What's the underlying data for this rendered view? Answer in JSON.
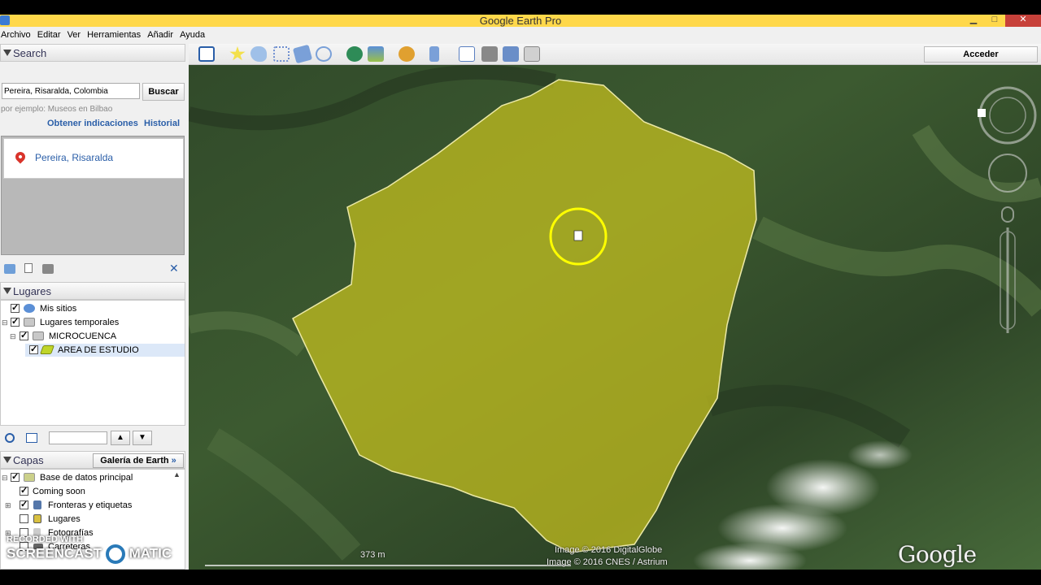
{
  "window": {
    "title": "Google Earth Pro",
    "minimize": "▁",
    "maximize": "□",
    "close": "✕"
  },
  "menu": [
    "Archivo",
    "Editar",
    "Ver",
    "Herramientas",
    "Añadir",
    "Ayuda"
  ],
  "search": {
    "title": "Search",
    "input_value": "Pereira, Risaralda, Colombia",
    "button_label": "Buscar",
    "hint": "por ejemplo: Museos en Bilbao",
    "directions_link": "Obtener indicaciones",
    "history_link": "Historial",
    "result": "Pereira, Risaralda"
  },
  "places": {
    "title": "Lugares",
    "items": [
      {
        "label": "Mis sitios",
        "checked": true
      },
      {
        "label": "Lugares temporales",
        "checked": true
      },
      {
        "label": "MICROCUENCA",
        "checked": true
      },
      {
        "label": "AREA DE ESTUDIO",
        "checked": true
      }
    ]
  },
  "layers": {
    "title": "Capas",
    "gallery_button": "Galería de Earth",
    "gallery_arrow": "»",
    "items": [
      {
        "label": "Base de datos principal",
        "checked": true
      },
      {
        "label": "Coming soon",
        "checked": true
      },
      {
        "label": "Fronteras y etiquetas",
        "checked": true
      },
      {
        "label": "Lugares",
        "checked": false
      },
      {
        "label": "Fotografías",
        "checked": false
      },
      {
        "label": "Carreteras",
        "checked": false
      }
    ]
  },
  "toolbar": {
    "signin_label": "Acceder"
  },
  "map": {
    "attribution_1": "Image © 2016 DigitalGlobe",
    "attribution_2": "Image © 2016 CNES / Astrium",
    "scale": "373 m",
    "logo": "Google earth",
    "polygon_color": "#c8c21e",
    "cursor_ring_color": "#ffff00"
  },
  "watermark": {
    "line1": "RECORDED WITH",
    "line2": "SCREENCAST",
    "line3": "MATIC"
  }
}
